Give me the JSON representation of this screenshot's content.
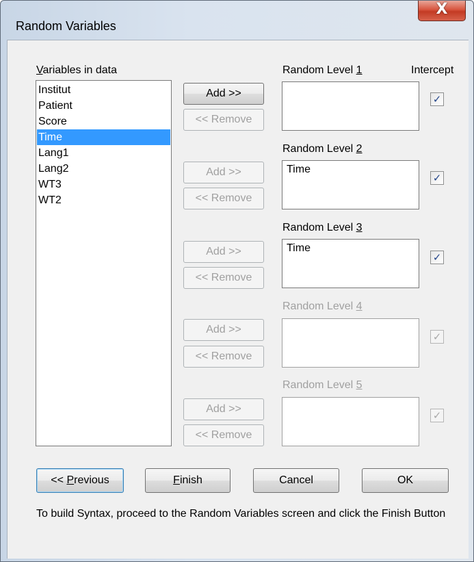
{
  "window": {
    "title": "Random Variables",
    "close_label": "X"
  },
  "variables": {
    "label_u": "V",
    "label_rest": "ariables in data",
    "items": [
      "Institut",
      "Patient",
      "Score",
      "Time",
      "Lang1",
      "Lang2",
      "WT3",
      "WT2"
    ],
    "selected": "Time"
  },
  "intercept_label": "Intercept",
  "levels": [
    {
      "label_pre": "Random Level ",
      "label_u": "1",
      "value": "",
      "add_label": "Add >>",
      "remove_label": "<< Remove",
      "intercept_checked": "✓"
    },
    {
      "label_pre": "Random Level ",
      "label_u": "2",
      "value": "Time",
      "add_label": "Add >>",
      "remove_label": "<< Remove",
      "intercept_checked": "✓"
    },
    {
      "label_pre": "Random Level ",
      "label_u": "3",
      "value": "Time",
      "add_label": "Add >>",
      "remove_label": "<< Remove",
      "intercept_checked": "✓"
    },
    {
      "label_pre": "Random Level ",
      "label_u": "4",
      "value": "",
      "add_label": "Add >>",
      "remove_label": "<< Remove",
      "intercept_checked": "✓"
    },
    {
      "label_pre": "Random Level ",
      "label_u": "5",
      "value": "",
      "add_label": "Add >>",
      "remove_label": "<< Remove",
      "intercept_checked": "✓"
    }
  ],
  "buttons": {
    "previous_pre": "<< ",
    "previous_u": "P",
    "previous_rest": "revious",
    "finish_u": "F",
    "finish_rest": "inish",
    "cancel": "Cancel",
    "ok": "OK"
  },
  "note": "To build  Syntax, proceed to the Random Variables screen and click the Finish Button"
}
